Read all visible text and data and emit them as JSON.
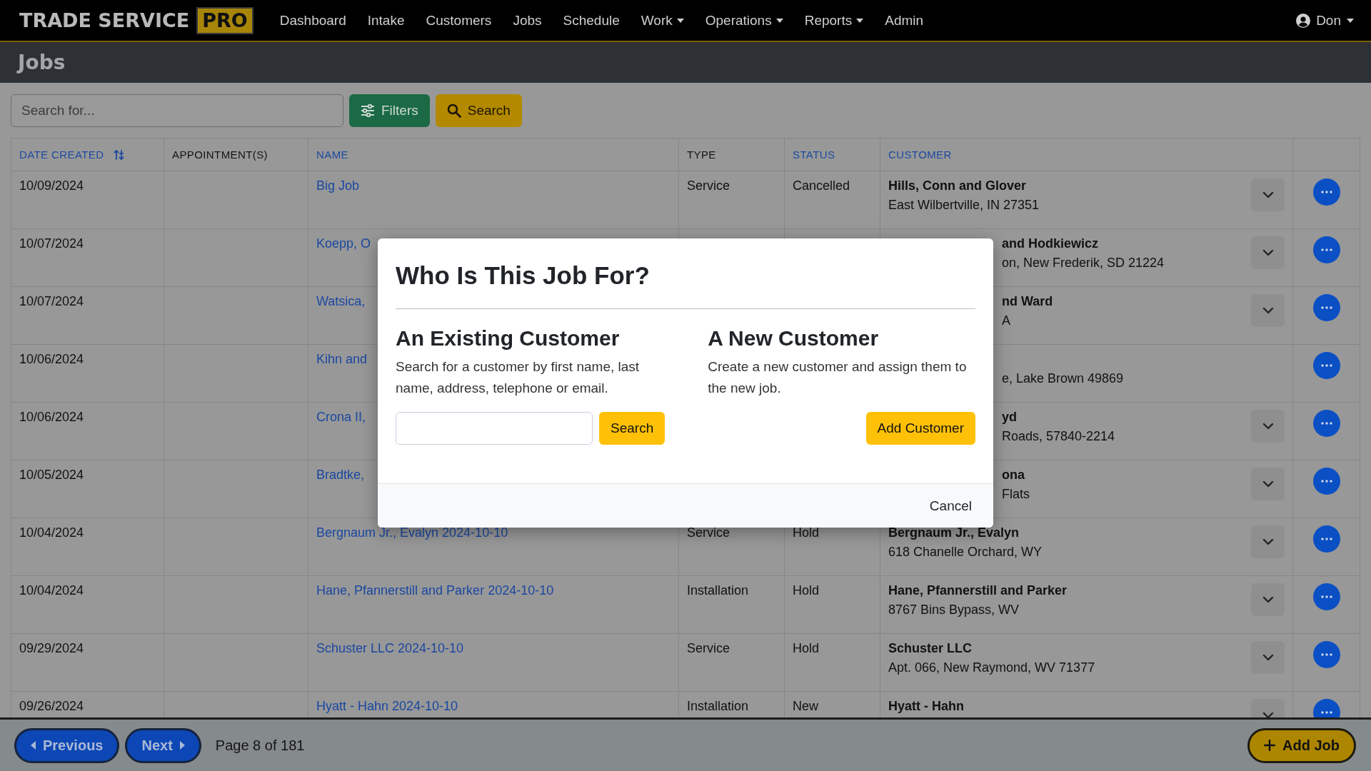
{
  "nav": {
    "logo_text": "TRADE SERVICE",
    "logo_badge": "PRO",
    "items": [
      {
        "label": "Dashboard",
        "dropdown": false
      },
      {
        "label": "Intake",
        "dropdown": false
      },
      {
        "label": "Customers",
        "dropdown": false
      },
      {
        "label": "Jobs",
        "dropdown": false
      },
      {
        "label": "Schedule",
        "dropdown": false
      },
      {
        "label": "Work",
        "dropdown": true
      },
      {
        "label": "Operations",
        "dropdown": true
      },
      {
        "label": "Reports",
        "dropdown": true
      },
      {
        "label": "Admin",
        "dropdown": false
      }
    ],
    "user": "Don"
  },
  "page_title": "Jobs",
  "toolbar": {
    "search_placeholder": "Search for...",
    "filters_button": "Filters",
    "search_button": "Search"
  },
  "table": {
    "columns": [
      {
        "label": "DATE CREATED",
        "sortable": true,
        "sorted": true
      },
      {
        "label": "APPOINTMENT(S)",
        "sortable": false,
        "sorted": false
      },
      {
        "label": "NAME",
        "sortable": true,
        "sorted": false
      },
      {
        "label": "TYPE",
        "sortable": false,
        "sorted": false
      },
      {
        "label": "STATUS",
        "sortable": true,
        "sorted": false
      },
      {
        "label": "CUSTOMER",
        "sortable": true,
        "sorted": false
      }
    ],
    "rows": [
      {
        "date": "10/09/2024",
        "name": "Big Job",
        "type": "Service",
        "status": "Cancelled",
        "customer_name": "Hills, Conn and Glover",
        "customer_address": "East Wilbertville, IN 27351",
        "expand_button": true
      },
      {
        "date": "10/07/2024",
        "name": "Koepp, O",
        "customer_name": "and Hodkiewicz",
        "customer_address": "on, New Frederik, SD 21224",
        "expand_button": true
      },
      {
        "date": "10/07/2024",
        "name": "Watsica,",
        "customer_name": "nd Ward",
        "customer_address": "A",
        "expand_button": true
      },
      {
        "date": "10/06/2024",
        "name": "Kihn and",
        "customer_address": "e, Lake Brown 49869",
        "expand_button": false
      },
      {
        "date": "10/06/2024",
        "name": "Crona II,",
        "customer_name": "yd",
        "customer_address": "Roads, 57840-2214",
        "expand_button": true
      },
      {
        "date": "10/05/2024",
        "name": "Bradtke,",
        "customer_name": "ona",
        "customer_address": "Flats",
        "expand_button": true
      },
      {
        "date": "10/04/2024",
        "name": "Bergnaum Jr., Evalyn 2024-10-10",
        "type": "Service",
        "status": "Hold",
        "customer_name": "Bergnaum Jr., Evalyn",
        "customer_address": "618 Chanelle Orchard, WY",
        "expand_button": true
      },
      {
        "date": "10/04/2024",
        "name": "Hane, Pfannerstill and Parker 2024-10-10",
        "type": "Installation",
        "status": "Hold",
        "customer_name": "Hane, Pfannerstill and Parker",
        "customer_address": "8767 Bins Bypass, WV",
        "expand_button": true
      },
      {
        "date": "09/29/2024",
        "name": "Schuster LLC 2024-10-10",
        "type": "Service",
        "status": "Hold",
        "customer_name": "Schuster LLC",
        "customer_address": "Apt. 066, New Raymond, WV 71377",
        "expand_button": true
      },
      {
        "date": "09/26/2024",
        "name": "Hyatt - Hahn 2024-10-10",
        "type": "Installation",
        "status": "New",
        "customer_name": "Hyatt - Hahn",
        "expand_button": true
      }
    ]
  },
  "footer": {
    "previous_button": "Previous",
    "next_button": "Next",
    "page_info": "Page 8 of 181",
    "add_button": "Add Job"
  },
  "modal": {
    "title": "Who Is This Job For?",
    "existing": {
      "heading": "An Existing Customer",
      "description": "Search for a customer by first name, last name, address, telephone or email.",
      "search_button": "Search"
    },
    "new": {
      "heading": "A New Customer",
      "description": "Create a new customer and assign them to the new job.",
      "add_button": "Add Customer"
    },
    "cancel_button": "Cancel"
  }
}
